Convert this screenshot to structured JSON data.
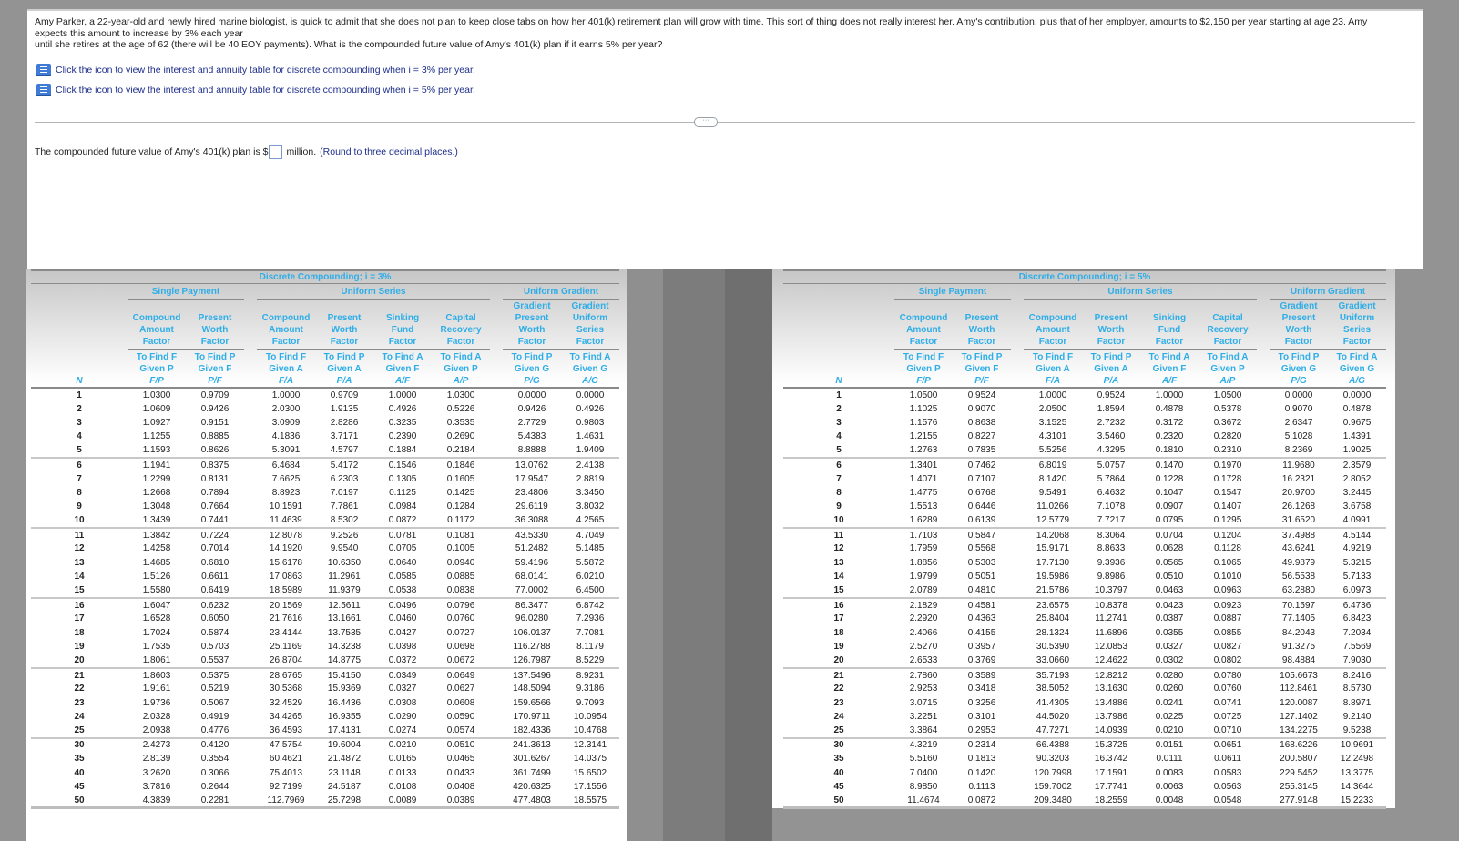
{
  "question": {
    "line1": "Amy Parker, a 22-year-old and newly hired marine biologist, is quick to admit that she does not plan to keep close tabs on how her 401(k) retirement plan will grow with time. This sort of thing does not really interest her. Amy's contribution, plus that of her employer, amounts to $2,150 per year starting at age 23. Amy expects this amount to increase by 3% each year",
    "line2": "until she retires at the age of 62 (there will be 40 EOY payments). What is the compounded future value of Amy's 401(k) plan if it earns 5% per year?",
    "link_3": "Click the icon to view the interest and annuity table for discrete compounding when i = 3% per year.",
    "link_5": "Click the icon to view the interest and annuity table for discrete compounding when i = 5% per year.",
    "more_label": "···",
    "answer_prefix": "The compounded future value of Amy's 401(k) plan is $",
    "answer_value": "",
    "answer_suffix": "million.",
    "answer_hint": "(Round to three decimal places.)"
  },
  "headers": {
    "single_payment": "Single Payment",
    "uniform_series": "Uniform Series",
    "uniform_gradient": "Uniform Gradient",
    "n": "N"
  },
  "table3": {
    "title": "Discrete Compounding; i = 3%",
    "columns": [
      {
        "name": "Compound Amount Factor",
        "find": "To Find F Given P",
        "sym": "F/P"
      },
      {
        "name": "Present Worth Factor",
        "find": "To Find P Given F",
        "sym": "P/F"
      },
      {
        "name": "Compound Amount Factor",
        "find": "To Find F Given A",
        "sym": "F/A"
      },
      {
        "name": "Present Worth Factor",
        "find": "To Find P Given A",
        "sym": "P/A"
      },
      {
        "name": "Sinking Fund Factor",
        "find": "To Find A Given F",
        "sym": "A/F"
      },
      {
        "name": "Capital Recovery Factor",
        "find": "To Find A Given P",
        "sym": "A/P"
      },
      {
        "name": "Gradient Present Worth Factor",
        "find": "To Find P Given G",
        "sym": "P/G"
      },
      {
        "name": "Gradient Uniform Series Factor",
        "find": "To Find A Given G",
        "sym": "A/G"
      }
    ],
    "rows": [
      [
        "1",
        "1.0300",
        "0.9709",
        "1.0000",
        "0.9709",
        "1.0000",
        "1.0300",
        "0.0000",
        "0.0000"
      ],
      [
        "2",
        "1.0609",
        "0.9426",
        "2.0300",
        "1.9135",
        "0.4926",
        "0.5226",
        "0.9426",
        "0.4926"
      ],
      [
        "3",
        "1.0927",
        "0.9151",
        "3.0909",
        "2.8286",
        "0.3235",
        "0.3535",
        "2.7729",
        "0.9803"
      ],
      [
        "4",
        "1.1255",
        "0.8885",
        "4.1836",
        "3.7171",
        "0.2390",
        "0.2690",
        "5.4383",
        "1.4631"
      ],
      [
        "5",
        "1.1593",
        "0.8626",
        "5.3091",
        "4.5797",
        "0.1884",
        "0.2184",
        "8.8888",
        "1.9409"
      ],
      [
        "6",
        "1.1941",
        "0.8375",
        "6.4684",
        "5.4172",
        "0.1546",
        "0.1846",
        "13.0762",
        "2.4138"
      ],
      [
        "7",
        "1.2299",
        "0.8131",
        "7.6625",
        "6.2303",
        "0.1305",
        "0.1605",
        "17.9547",
        "2.8819"
      ],
      [
        "8",
        "1.2668",
        "0.7894",
        "8.8923",
        "7.0197",
        "0.1125",
        "0.1425",
        "23.4806",
        "3.3450"
      ],
      [
        "9",
        "1.3048",
        "0.7664",
        "10.1591",
        "7.7861",
        "0.0984",
        "0.1284",
        "29.6119",
        "3.8032"
      ],
      [
        "10",
        "1.3439",
        "0.7441",
        "11.4639",
        "8.5302",
        "0.0872",
        "0.1172",
        "36.3088",
        "4.2565"
      ],
      [
        "11",
        "1.3842",
        "0.7224",
        "12.8078",
        "9.2526",
        "0.0781",
        "0.1081",
        "43.5330",
        "4.7049"
      ],
      [
        "12",
        "1.4258",
        "0.7014",
        "14.1920",
        "9.9540",
        "0.0705",
        "0.1005",
        "51.2482",
        "5.1485"
      ],
      [
        "13",
        "1.4685",
        "0.6810",
        "15.6178",
        "10.6350",
        "0.0640",
        "0.0940",
        "59.4196",
        "5.5872"
      ],
      [
        "14",
        "1.5126",
        "0.6611",
        "17.0863",
        "11.2961",
        "0.0585",
        "0.0885",
        "68.0141",
        "6.0210"
      ],
      [
        "15",
        "1.5580",
        "0.6419",
        "18.5989",
        "11.9379",
        "0.0538",
        "0.0838",
        "77.0002",
        "6.4500"
      ],
      [
        "16",
        "1.6047",
        "0.6232",
        "20.1569",
        "12.5611",
        "0.0496",
        "0.0796",
        "86.3477",
        "6.8742"
      ],
      [
        "17",
        "1.6528",
        "0.6050",
        "21.7616",
        "13.1661",
        "0.0460",
        "0.0760",
        "96.0280",
        "7.2936"
      ],
      [
        "18",
        "1.7024",
        "0.5874",
        "23.4144",
        "13.7535",
        "0.0427",
        "0.0727",
        "106.0137",
        "7.7081"
      ],
      [
        "19",
        "1.7535",
        "0.5703",
        "25.1169",
        "14.3238",
        "0.0398",
        "0.0698",
        "116.2788",
        "8.1179"
      ],
      [
        "20",
        "1.8061",
        "0.5537",
        "26.8704",
        "14.8775",
        "0.0372",
        "0.0672",
        "126.7987",
        "8.5229"
      ],
      [
        "21",
        "1.8603",
        "0.5375",
        "28.6765",
        "15.4150",
        "0.0349",
        "0.0649",
        "137.5496",
        "8.9231"
      ],
      [
        "22",
        "1.9161",
        "0.5219",
        "30.5368",
        "15.9369",
        "0.0327",
        "0.0627",
        "148.5094",
        "9.3186"
      ],
      [
        "23",
        "1.9736",
        "0.5067",
        "32.4529",
        "16.4436",
        "0.0308",
        "0.0608",
        "159.6566",
        "9.7093"
      ],
      [
        "24",
        "2.0328",
        "0.4919",
        "34.4265",
        "16.9355",
        "0.0290",
        "0.0590",
        "170.9711",
        "10.0954"
      ],
      [
        "25",
        "2.0938",
        "0.4776",
        "36.4593",
        "17.4131",
        "0.0274",
        "0.0574",
        "182.4336",
        "10.4768"
      ],
      [
        "30",
        "2.4273",
        "0.4120",
        "47.5754",
        "19.6004",
        "0.0210",
        "0.0510",
        "241.3613",
        "12.3141"
      ],
      [
        "35",
        "2.8139",
        "0.3554",
        "60.4621",
        "21.4872",
        "0.0165",
        "0.0465",
        "301.6267",
        "14.0375"
      ],
      [
        "40",
        "3.2620",
        "0.3066",
        "75.4013",
        "23.1148",
        "0.0133",
        "0.0433",
        "361.7499",
        "15.6502"
      ],
      [
        "45",
        "3.7816",
        "0.2644",
        "92.7199",
        "24.5187",
        "0.0108",
        "0.0408",
        "420.6325",
        "17.1556"
      ],
      [
        "50",
        "4.3839",
        "0.2281",
        "112.7969",
        "25.7298",
        "0.0089",
        "0.0389",
        "477.4803",
        "18.5575"
      ]
    ]
  },
  "table5": {
    "title": "Discrete Compounding; i = 5%",
    "columns": [
      {
        "name": "Compound Amount Factor",
        "find": "To Find F Given P",
        "sym": "F/P"
      },
      {
        "name": "Present Worth Factor",
        "find": "To Find P Given F",
        "sym": "P/F"
      },
      {
        "name": "Compound Amount Factor",
        "find": "To Find F Given A",
        "sym": "F/A"
      },
      {
        "name": "Present Worth Factor",
        "find": "To Find P Given A",
        "sym": "P/A"
      },
      {
        "name": "Sinking Fund Factor",
        "find": "To Find A Given F",
        "sym": "A/F"
      },
      {
        "name": "Capital Recovery Factor",
        "find": "To Find A Given P",
        "sym": "A/P"
      },
      {
        "name": "Gradient Present Worth Factor",
        "find": "To Find P Given G",
        "sym": "P/G"
      },
      {
        "name": "Gradient Uniform Series Factor",
        "find": "To Find A Given G",
        "sym": "A/G"
      }
    ],
    "rows": [
      [
        "1",
        "1.0500",
        "0.9524",
        "1.0000",
        "0.9524",
        "1.0000",
        "1.0500",
        "0.0000",
        "0.0000"
      ],
      [
        "2",
        "1.1025",
        "0.9070",
        "2.0500",
        "1.8594",
        "0.4878",
        "0.5378",
        "0.9070",
        "0.4878"
      ],
      [
        "3",
        "1.1576",
        "0.8638",
        "3.1525",
        "2.7232",
        "0.3172",
        "0.3672",
        "2.6347",
        "0.9675"
      ],
      [
        "4",
        "1.2155",
        "0.8227",
        "4.3101",
        "3.5460",
        "0.2320",
        "0.2820",
        "5.1028",
        "1.4391"
      ],
      [
        "5",
        "1.2763",
        "0.7835",
        "5.5256",
        "4.3295",
        "0.1810",
        "0.2310",
        "8.2369",
        "1.9025"
      ],
      [
        "6",
        "1.3401",
        "0.7462",
        "6.8019",
        "5.0757",
        "0.1470",
        "0.1970",
        "11.9680",
        "2.3579"
      ],
      [
        "7",
        "1.4071",
        "0.7107",
        "8.1420",
        "5.7864",
        "0.1228",
        "0.1728",
        "16.2321",
        "2.8052"
      ],
      [
        "8",
        "1.4775",
        "0.6768",
        "9.5491",
        "6.4632",
        "0.1047",
        "0.1547",
        "20.9700",
        "3.2445"
      ],
      [
        "9",
        "1.5513",
        "0.6446",
        "11.0266",
        "7.1078",
        "0.0907",
        "0.1407",
        "26.1268",
        "3.6758"
      ],
      [
        "10",
        "1.6289",
        "0.6139",
        "12.5779",
        "7.7217",
        "0.0795",
        "0.1295",
        "31.6520",
        "4.0991"
      ],
      [
        "11",
        "1.7103",
        "0.5847",
        "14.2068",
        "8.3064",
        "0.0704",
        "0.1204",
        "37.4988",
        "4.5144"
      ],
      [
        "12",
        "1.7959",
        "0.5568",
        "15.9171",
        "8.8633",
        "0.0628",
        "0.1128",
        "43.6241",
        "4.9219"
      ],
      [
        "13",
        "1.8856",
        "0.5303",
        "17.7130",
        "9.3936",
        "0.0565",
        "0.1065",
        "49.9879",
        "5.3215"
      ],
      [
        "14",
        "1.9799",
        "0.5051",
        "19.5986",
        "9.8986",
        "0.0510",
        "0.1010",
        "56.5538",
        "5.7133"
      ],
      [
        "15",
        "2.0789",
        "0.4810",
        "21.5786",
        "10.3797",
        "0.0463",
        "0.0963",
        "63.2880",
        "6.0973"
      ],
      [
        "16",
        "2.1829",
        "0.4581",
        "23.6575",
        "10.8378",
        "0.0423",
        "0.0923",
        "70.1597",
        "6.4736"
      ],
      [
        "17",
        "2.2920",
        "0.4363",
        "25.8404",
        "11.2741",
        "0.0387",
        "0.0887",
        "77.1405",
        "6.8423"
      ],
      [
        "18",
        "2.4066",
        "0.4155",
        "28.1324",
        "11.6896",
        "0.0355",
        "0.0855",
        "84.2043",
        "7.2034"
      ],
      [
        "19",
        "2.5270",
        "0.3957",
        "30.5390",
        "12.0853",
        "0.0327",
        "0.0827",
        "91.3275",
        "7.5569"
      ],
      [
        "20",
        "2.6533",
        "0.3769",
        "33.0660",
        "12.4622",
        "0.0302",
        "0.0802",
        "98.4884",
        "7.9030"
      ],
      [
        "21",
        "2.7860",
        "0.3589",
        "35.7193",
        "12.8212",
        "0.0280",
        "0.0780",
        "105.6673",
        "8.2416"
      ],
      [
        "22",
        "2.9253",
        "0.3418",
        "38.5052",
        "13.1630",
        "0.0260",
        "0.0760",
        "112.8461",
        "8.5730"
      ],
      [
        "23",
        "3.0715",
        "0.3256",
        "41.4305",
        "13.4886",
        "0.0241",
        "0.0741",
        "120.0087",
        "8.8971"
      ],
      [
        "24",
        "3.2251",
        "0.3101",
        "44.5020",
        "13.7986",
        "0.0225",
        "0.0725",
        "127.1402",
        "9.2140"
      ],
      [
        "25",
        "3.3864",
        "0.2953",
        "47.7271",
        "14.0939",
        "0.0210",
        "0.0710",
        "134.2275",
        "9.5238"
      ],
      [
        "30",
        "4.3219",
        "0.2314",
        "66.4388",
        "15.3725",
        "0.0151",
        "0.0651",
        "168.6226",
        "10.9691"
      ],
      [
        "35",
        "5.5160",
        "0.1813",
        "90.3203",
        "16.3742",
        "0.0111",
        "0.0611",
        "200.5807",
        "12.2498"
      ],
      [
        "40",
        "7.0400",
        "0.1420",
        "120.7998",
        "17.1591",
        "0.0083",
        "0.0583",
        "229.5452",
        "13.3775"
      ],
      [
        "45",
        "8.9850",
        "0.1113",
        "159.7002",
        "17.7741",
        "0.0063",
        "0.0563",
        "255.3145",
        "14.3644"
      ],
      [
        "50",
        "11.4674",
        "0.0872",
        "209.3480",
        "18.2559",
        "0.0048",
        "0.0548",
        "277.9148",
        "15.2233"
      ]
    ]
  }
}
